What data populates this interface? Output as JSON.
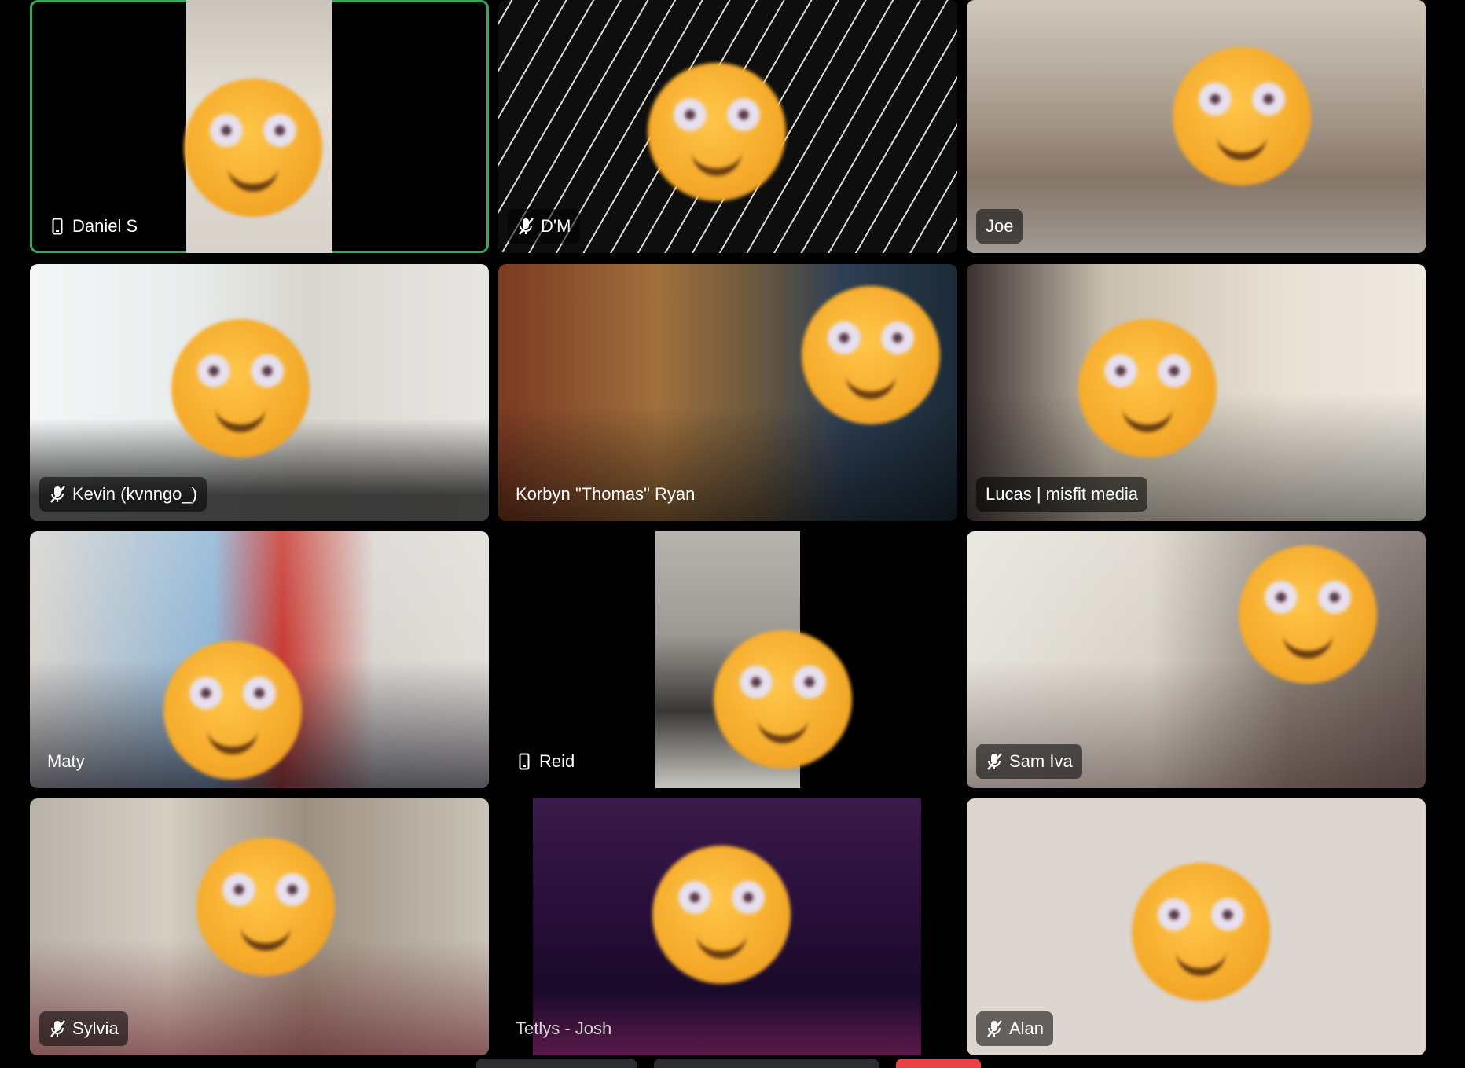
{
  "participants": [
    {
      "name": "Daniel S",
      "status_icon": "mobile-phone-icon"
    },
    {
      "name": "D'M",
      "status_icon": "muted-microphone-icon"
    },
    {
      "name": "Joe",
      "status_icon": ""
    },
    {
      "name": "Kevin (kvnngo_)",
      "status_icon": "muted-microphone-icon"
    },
    {
      "name": "Korbyn \"Thomas\" Ryan",
      "status_icon": ""
    },
    {
      "name": "Lucas | misfit media",
      "status_icon": ""
    },
    {
      "name": "Maty",
      "status_icon": ""
    },
    {
      "name": "Reid",
      "status_icon": "mobile-phone-icon"
    },
    {
      "name": "Sam Iva",
      "status_icon": "muted-microphone-icon"
    },
    {
      "name": "Sylvia",
      "status_icon": "muted-microphone-icon"
    },
    {
      "name": "Tetlys - Josh",
      "status_icon": ""
    },
    {
      "name": "Alan",
      "status_icon": "muted-microphone-icon"
    }
  ],
  "colors": {
    "background": "#000000",
    "speaking_border": "#3ba55d",
    "label_background": "rgba(0,0,0,0.55)",
    "leave_button": "#ed4245"
  }
}
